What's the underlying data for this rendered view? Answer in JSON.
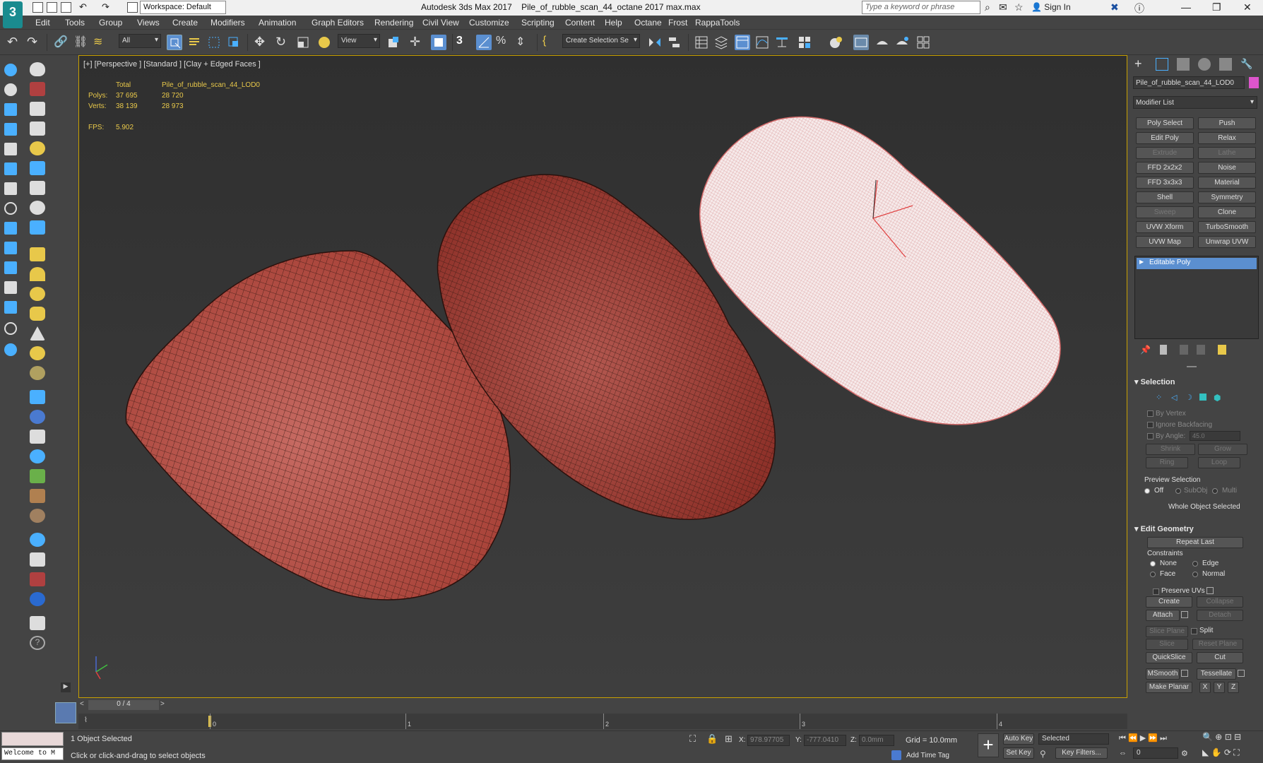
{
  "window": {
    "app_title": "Autodesk 3ds Max 2017",
    "file_title": "Pile_of_rubble_scan_44_octane 2017 max.max",
    "workspace": "Workspace: Default",
    "search_placeholder": "Type a keyword or phrase",
    "sign_in": "Sign In",
    "logo": "3"
  },
  "menus": [
    "Edit",
    "Tools",
    "Group",
    "Views",
    "Create",
    "Modifiers",
    "Animation",
    "Graph Editors",
    "Rendering",
    "Civil View",
    "Customize",
    "Scripting",
    "Content",
    "Help",
    "Octane",
    "Frost",
    "RappaTools"
  ],
  "toolbar": {
    "filter": "All",
    "ref_coord": "View",
    "snap_label": "3",
    "selection_set": "Create Selection Se"
  },
  "viewport": {
    "label": "[+] [Perspective ] [Standard ] [Clay + Edged Faces ]",
    "stats": {
      "total_label": "Total",
      "object_label": "Pile_of_rubble_scan_44_LOD0",
      "polys_label": "Polys:",
      "polys_total": "37 695",
      "polys_object": "28 720",
      "verts_label": "Verts:",
      "verts_total": "38 139",
      "verts_object": "28 973",
      "fps_label": "FPS:",
      "fps_value": "5.902"
    }
  },
  "command_panel": {
    "object_name": "Pile_of_rubble_scan_44_LOD0",
    "object_color": "#dd55cc",
    "modifier_list": "Modifier List",
    "modifier_buttons": [
      {
        "label": "Poly Select",
        "enabled": true
      },
      {
        "label": "Push",
        "enabled": true
      },
      {
        "label": "Edit Poly",
        "enabled": true
      },
      {
        "label": "Relax",
        "enabled": true
      },
      {
        "label": "Extrude",
        "enabled": false
      },
      {
        "label": "Lathe",
        "enabled": false
      },
      {
        "label": "FFD 2x2x2",
        "enabled": true
      },
      {
        "label": "Noise",
        "enabled": true
      },
      {
        "label": "FFD 3x3x3",
        "enabled": true
      },
      {
        "label": "Material",
        "enabled": true
      },
      {
        "label": "Shell",
        "enabled": true
      },
      {
        "label": "Symmetry",
        "enabled": true
      },
      {
        "label": "Sweep",
        "enabled": false
      },
      {
        "label": "Clone",
        "enabled": true
      },
      {
        "label": "UVW Xform",
        "enabled": true
      },
      {
        "label": "TurboSmooth",
        "enabled": true
      },
      {
        "label": "UVW Map",
        "enabled": true
      },
      {
        "label": "Unwrap UVW",
        "enabled": true
      }
    ],
    "stack_item": "Editable Poly",
    "selection": {
      "title": "Selection",
      "by_vertex": "By Vertex",
      "ignore_backfacing": "Ignore Backfacing",
      "by_angle": "By Angle:",
      "angle_value": "45.0",
      "shrink": "Shrink",
      "grow": "Grow",
      "ring": "Ring",
      "loop": "Loop",
      "preview_selection": "Preview Selection",
      "off": "Off",
      "subobj": "SubObj",
      "multi": "Multi",
      "whole_object": "Whole Object Selected"
    },
    "edit_geometry": {
      "title": "Edit Geometry",
      "repeat_last": "Repeat Last",
      "constraints": "Constraints",
      "none": "None",
      "edge": "Edge",
      "face": "Face",
      "normal": "Normal",
      "preserve_uvs": "Preserve UVs",
      "create": "Create",
      "collapse": "Collapse",
      "attach": "Attach",
      "detach": "Detach",
      "slice_plane": "Slice Plane",
      "split": "Split",
      "slice": "Slice",
      "reset_plane": "Reset Plane",
      "quickslice": "QuickSlice",
      "cut": "Cut",
      "msmooth": "MSmooth",
      "tessellate": "Tessellate",
      "make_planar": "Make Planar",
      "x": "X",
      "y": "Y",
      "z": "Z"
    }
  },
  "timeline": {
    "frame_display": "0 / 4",
    "ticks": [
      "0",
      "1",
      "2",
      "3",
      "4"
    ]
  },
  "status": {
    "script_listener": "Welcome to M",
    "selected": "1 Object Selected",
    "prompt": "Click or click-and-drag to select objects",
    "x_label": "X:",
    "x_value": "978.97705",
    "y_label": "Y:",
    "y_value": "-777.0410",
    "z_label": "Z:",
    "z_value": "0.0mm",
    "grid": "Grid = 10.0mm",
    "add_time_tag": "Add Time Tag",
    "auto_key": "Auto Key",
    "set_key": "Set Key",
    "selected_dropdown": "Selected",
    "key_filters": "Key Filters...",
    "frame_field": "0"
  }
}
